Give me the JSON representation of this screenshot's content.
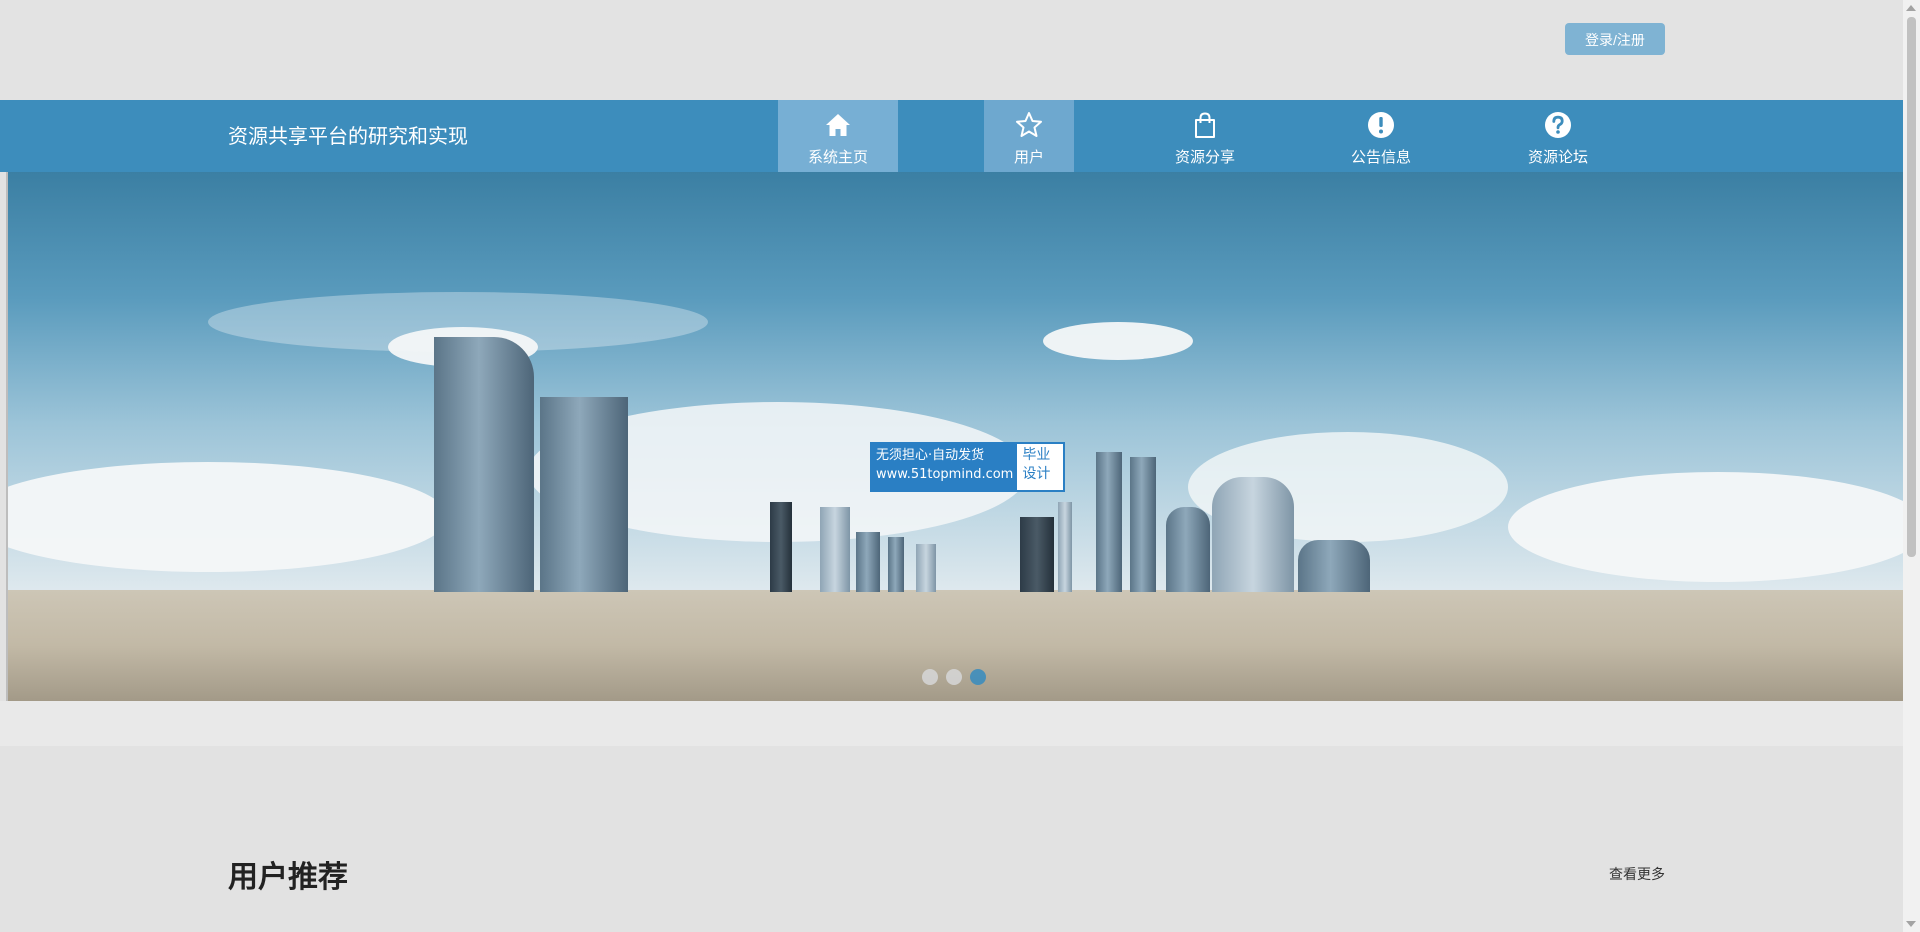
{
  "header": {
    "login_label": "登录/注册"
  },
  "navbar": {
    "title": "资源共享平台的研究和实现",
    "items": [
      {
        "label": "系统主页",
        "icon": "home-icon"
      },
      {
        "label": "用户",
        "icon": "star-icon"
      },
      {
        "label": "资源分享",
        "icon": "shopping-bag-icon"
      },
      {
        "label": "公告信息",
        "icon": "exclamation-icon"
      },
      {
        "label": "资源论坛",
        "icon": "question-icon"
      }
    ]
  },
  "banner": {
    "watermark_line1": "无须担心·自动发货",
    "watermark_line2": "www.51topmind.com",
    "watermark_badge": "毕业设计",
    "active_slide": 3,
    "slide_count": 3
  },
  "section": {
    "title": "用户推荐",
    "more_label": "查看更多"
  },
  "colors": {
    "nav_bg": "#3d8dbc",
    "nav_active": "#77afd4",
    "login_btn": "#7fb3d3",
    "page_bg": "#e2e2e2"
  }
}
